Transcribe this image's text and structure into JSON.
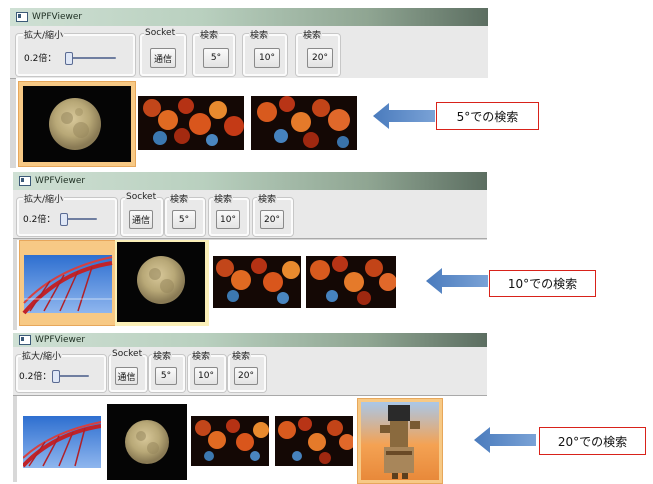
{
  "app": {
    "title": "WPFViewer"
  },
  "toolbar": {
    "zoom_group": "拡大/縮小",
    "zoom_value": "0.2倍：",
    "socket_group": "Socket",
    "socket_button": "通信",
    "search_group": "検索",
    "btn_5": "5°",
    "btn_10": "10°",
    "btn_20": "20°"
  },
  "annotations": {
    "a1": "5°での検索",
    "a2": "10°での検索",
    "a3": "20°での検索"
  },
  "colors": {
    "annotation_border": "#d8221a",
    "arrow": "#5b8ac6",
    "selection": "#f7c985"
  },
  "panels": [
    {
      "results": [
        "moon",
        "autumn-leaves",
        "autumn-leaves"
      ],
      "selected": "moon"
    },
    {
      "results": [
        "ferris-wheel",
        "moon",
        "autumn-leaves",
        "autumn-leaves"
      ],
      "selected": "ferris-wheel"
    },
    {
      "results": [
        "ferris-wheel",
        "moon",
        "autumn-leaves",
        "autumn-leaves",
        "statue"
      ],
      "selected": "statue"
    }
  ]
}
